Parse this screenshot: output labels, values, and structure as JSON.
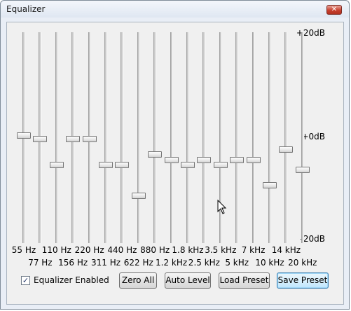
{
  "window": {
    "title": "Equalizer",
    "close_glyph": "✕"
  },
  "scale": {
    "top": "+20dB",
    "middle": "+0dB",
    "bottom": "-20dB"
  },
  "bands": [
    {
      "label": "55 Hz",
      "gain_db": 0.0
    },
    {
      "label": "77 Hz",
      "gain_db": -0.7
    },
    {
      "label": "110 Hz",
      "gain_db": -5.8
    },
    {
      "label": "156 Hz",
      "gain_db": -0.8
    },
    {
      "label": "220 Hz",
      "gain_db": -0.8
    },
    {
      "label": "311 Hz",
      "gain_db": -5.8
    },
    {
      "label": "440 Hz",
      "gain_db": -5.8
    },
    {
      "label": "622 Hz",
      "gain_db": -11.8
    },
    {
      "label": "880 Hz",
      "gain_db": -3.8
    },
    {
      "label": "1.2 kHz",
      "gain_db": -4.8
    },
    {
      "label": "1.8 kHz",
      "gain_db": -5.8
    },
    {
      "label": "2.5 kHz",
      "gain_db": -4.8
    },
    {
      "label": "3.5 kHz",
      "gain_db": -5.8
    },
    {
      "label": "5 kHz",
      "gain_db": -4.8
    },
    {
      "label": "7 kHz",
      "gain_db": -4.8
    },
    {
      "label": "10 kHz",
      "gain_db": -9.8
    },
    {
      "label": "14 kHz",
      "gain_db": -2.8
    },
    {
      "label": "20 kHz",
      "gain_db": -6.8
    }
  ],
  "footer": {
    "equalizer_enabled_label": "Equalizer Enabled",
    "equalizer_enabled_checked": true,
    "check_glyph": "✓",
    "zero_all": "Zero All",
    "auto_level": "Auto Level",
    "load_preset": "Load Preset",
    "save_preset": "Save Preset"
  }
}
